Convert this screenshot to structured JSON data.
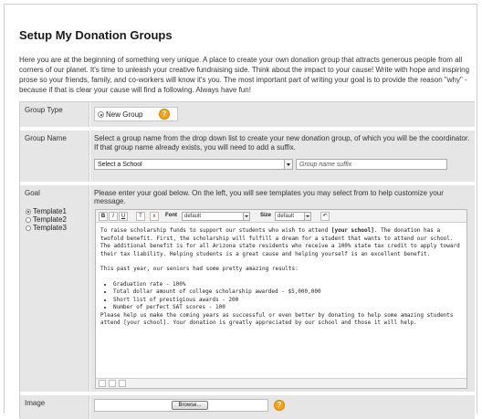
{
  "page": {
    "title": "Setup My Donation Groups",
    "intro": "Here you are at the beginning of something very unique. A place to create your own donation group that attracts generous people from all corners of our planet. It's time to unleash your creative fundraising side. Think about the impact to your cause! Write with hope and inspiring prose so your friends, family, and co-workers will know it's you. The most important part of writing your goal is to provide the reason \"why\" - because if that is clear your cause will find a following. Always have fun!"
  },
  "group_type": {
    "label": "Group Type",
    "option": "New Group",
    "help": "?"
  },
  "group_name": {
    "label": "Group Name",
    "instructions": "Select a group name from the drop down list to create your new donation group, of which you will be the coordinator. If that group name already exists, you will need to add a suffix.",
    "school_select": "Select a School",
    "suffix_placeholder": "Group name suffix"
  },
  "goal": {
    "label": "Goal",
    "instructions": "Please enter your goal below. On the left, you will see templates you may select from to help customize your message.",
    "templates": [
      "Template1",
      "Template2",
      "Template3"
    ],
    "toolbar": {
      "bold": "B",
      "italic": "I",
      "underline": "U",
      "text_color": "T",
      "clear": "x",
      "font_label": "Font",
      "font_value": "default",
      "size_label": "Size",
      "size_value": "default"
    },
    "content": {
      "p1_before": "To raise scholarship funds to support our students who wish to attend ",
      "p1_bold": "[your school]",
      "p1_after": ". The donation has a twofold benefit. First, the scholarship will fulfill a dream for a student that wants to attend our school. The additional benefit is for all Arizona state residents who receive a 100% state tax credit to apply toward their tax liability. Helping students is a great cause and helping yourself is an excellent benefit.",
      "p2": "This past year, our seniors had some pretty amazing results:",
      "bullets": [
        "Graduation rate - 100%",
        "Total dollar amount of college scholarship awarded - $5,000,000",
        "Short list of prestigious awards - 200",
        "Number of perfect SAT scores - 100"
      ],
      "p3": "Please help us make the coming years as successful or even better by donating to help some amazing students attend [your school]. Your donation is greatly appreciated by our school and those it will help."
    }
  },
  "image": {
    "label": "Image",
    "browse": "Browse...",
    "help": "?"
  }
}
